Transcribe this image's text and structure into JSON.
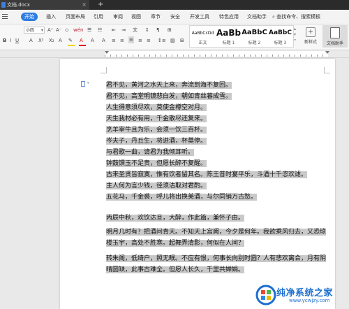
{
  "window": {
    "doc_tab": "文档.docx",
    "close_glyph": "×",
    "new_tab_glyph": "+"
  },
  "menu": {
    "items": [
      "开始",
      "插入",
      "页面布局",
      "引用",
      "审阅",
      "视图",
      "章节",
      "安全",
      "开发工具",
      "特色应用",
      "文档助手"
    ],
    "active": "开始",
    "search": "查找命令、搜索模板"
  },
  "toolbar": {
    "font_size": "小四",
    "styles": [
      {
        "sample": "AaBbCcDd",
        "name": "正文"
      },
      {
        "sample": "AaBb",
        "name": "标题 1"
      },
      {
        "sample": "AaBbC",
        "name": "标题 2"
      },
      {
        "sample": "AaBbC",
        "name": "标题 3"
      }
    ],
    "new_style": "新样式",
    "assistant": "文档助手"
  },
  "document": {
    "lines": [
      "君不见，黄河之水天上来，奔流到海不复回。",
      "君不见，高堂明镜悲白发，朝如青丝暮成雪。",
      "人生得意须尽欢，莫使金樽空对月。",
      "天生我材必有用，千金散尽还复来。",
      "烹羊宰牛且为乐，会须一饮三百杯。",
      "岑夫子，丹丘生，将进酒，杯莫停。",
      "与君歌一曲，请君为我倾耳听。",
      "钟鼓馔玉不足贵，但愿长醉不复醒。",
      "古来圣贤皆寂寞，惟有饮者留其名。陈王昔时宴平乐，斗酒十千恣欢谑。",
      "主人何为言少钱，径须沽取对君酌。",
      "五花马，千金裘，呼儿将出换美酒，与尔同销万古愁。"
    ],
    "para2": [
      "丙辰中秋，欢饮达旦，大醉，作此篇，兼怀子由。",
      "明月几时有？把酒问青天。不知天上宫阙，今夕是何年。我欲乘风归去，又恐琼",
      "楼玉宇，高处不胜寒。起舞弄清影，何似在人间？",
      "转朱阁，低绮户，照无眠。不应有恨，何事长向别时圆？人有悲欢离合，月有阴",
      "晴圆缺，此事古难全。但愿人长久，千里共婵娟。"
    ]
  },
  "watermark": {
    "title": "纯净系统之家",
    "url": "www.ycwjzy.com"
  },
  "colors": {
    "accent": "#2f7de1",
    "selection": "#c9c9c9",
    "watermark": "#1e6fd0"
  }
}
